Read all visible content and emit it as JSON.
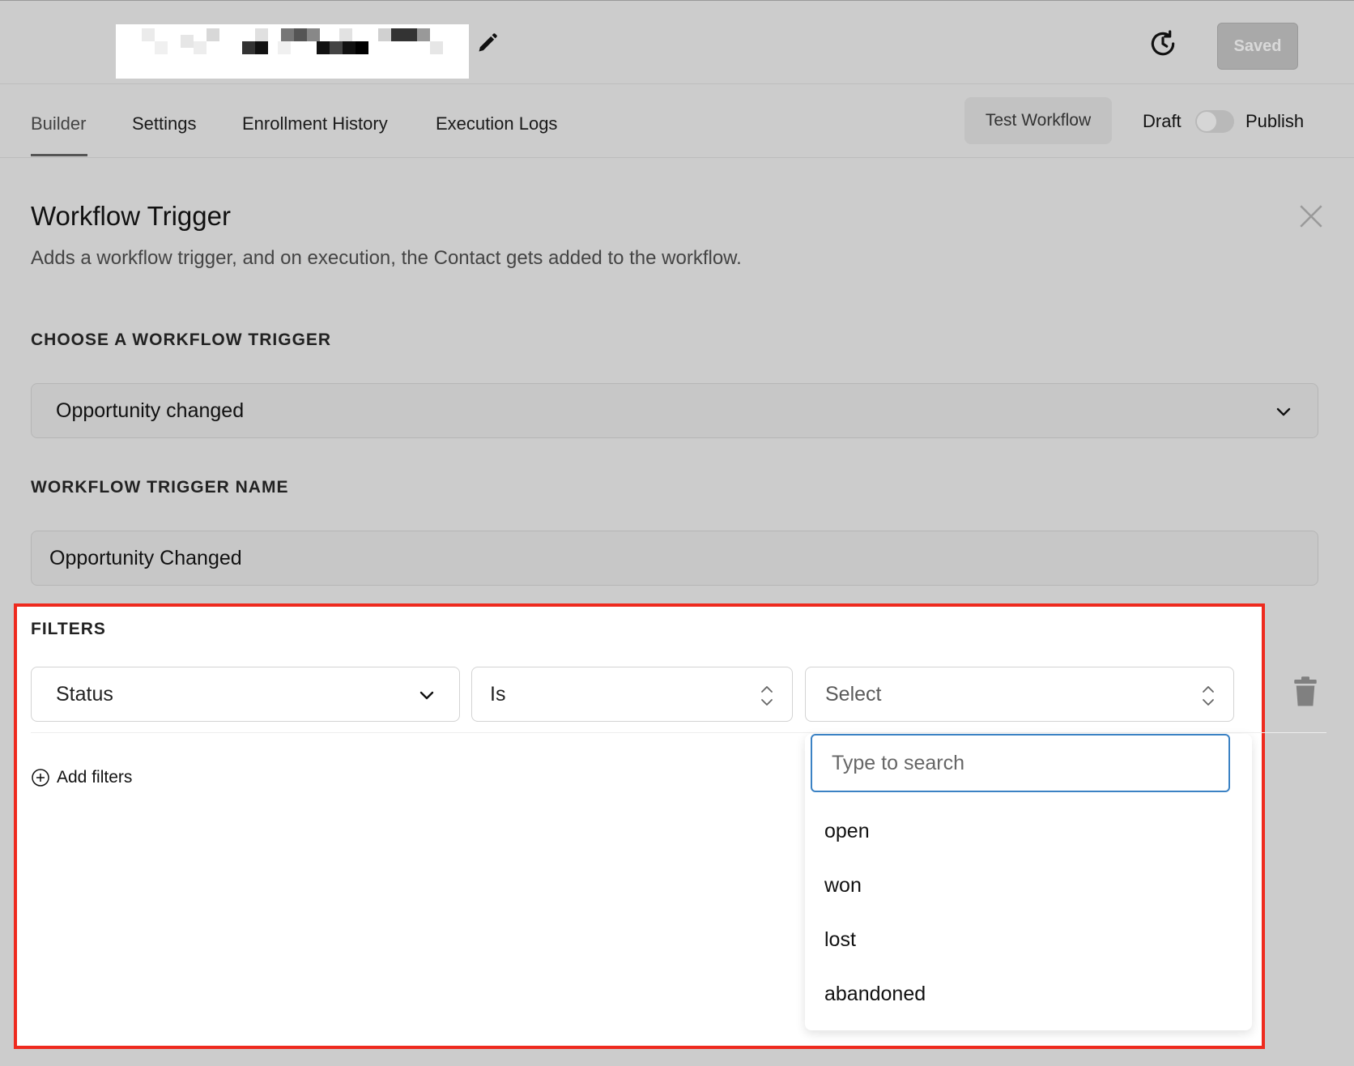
{
  "header": {
    "workflow_name_redacted": true,
    "saved_button": "Saved",
    "icons": [
      "pencil-edit-icon",
      "history-clock-icon"
    ]
  },
  "tabs": [
    {
      "label": "Builder",
      "active": true
    },
    {
      "label": "Settings",
      "active": false
    },
    {
      "label": "Enrollment History",
      "active": false
    },
    {
      "label": "Execution Logs",
      "active": false
    }
  ],
  "toolbar": {
    "test_button": "Test Workflow",
    "draft_label": "Draft",
    "publish_label": "Publish",
    "publish_toggle_on": false
  },
  "panel": {
    "title": "Workflow Trigger",
    "description": "Adds a workflow trigger, and on execution, the Contact gets added to the workflow.",
    "choose_label": "CHOOSE A WORKFLOW TRIGGER",
    "trigger_value": "Opportunity changed",
    "name_label": "WORKFLOW TRIGGER NAME",
    "name_value": "Opportunity Changed"
  },
  "filters": {
    "label": "FILTERS",
    "field_select": "Status",
    "operator_select": "Is",
    "value_select_placeholder": "Select",
    "search_placeholder": "Type to search",
    "options": [
      "open",
      "won",
      "lost",
      "abandoned"
    ],
    "add_filters_label": "Add filters"
  },
  "colors": {
    "highlight_border": "#ee2a1e",
    "focus_border": "#3b82c4",
    "overlay_bg": "#cccccc"
  }
}
